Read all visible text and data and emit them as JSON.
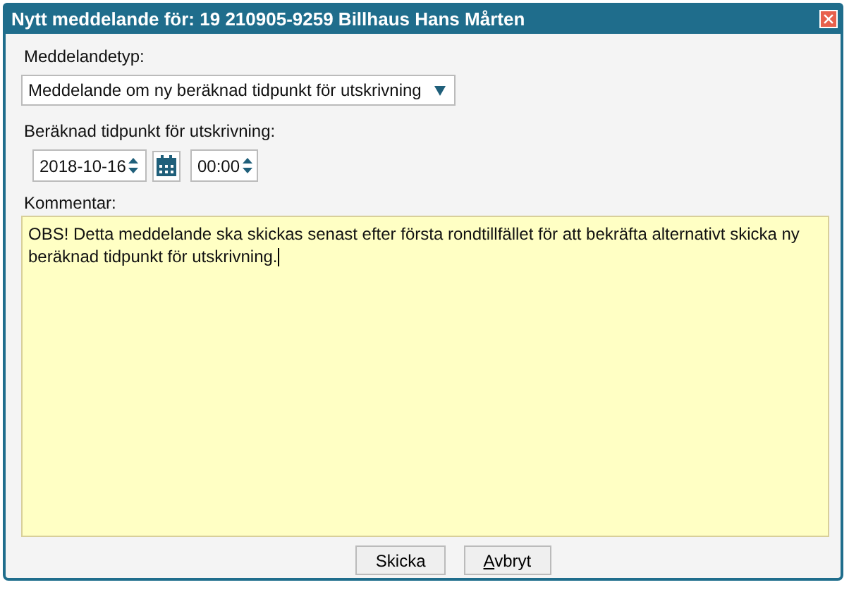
{
  "window": {
    "title": "Nytt meddelande för: 19 210905-9259 Billhaus Hans Mårten"
  },
  "message_type": {
    "label": "Meddelandetyp:",
    "value": "Meddelande om ny beräknad tidpunkt för utskrivning"
  },
  "discharge_time": {
    "label": "Beräknad tidpunkt för utskrivning:",
    "date": "2018-10-16",
    "time": "00:00"
  },
  "comment": {
    "label": "Kommentar:",
    "value": "OBS! Detta meddelande ska skickas senast efter första rondtillfället för att bekräfta alternativt skicka ny beräknad tidpunkt för utskrivning."
  },
  "buttons": [
    {
      "label": "Skicka",
      "underline_first": false
    },
    {
      "label": "Avbryt",
      "underline_first": true
    }
  ]
}
